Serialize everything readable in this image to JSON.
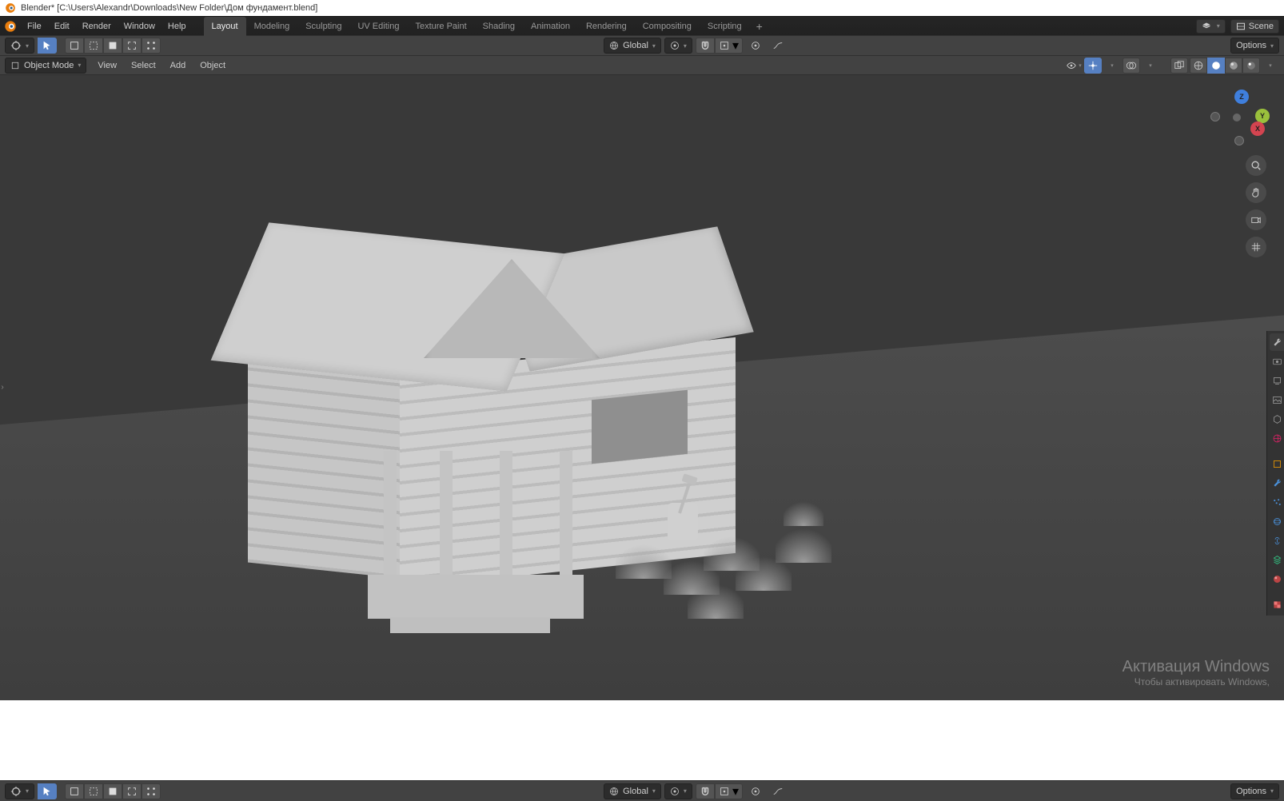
{
  "title": "Blender* [C:\\Users\\Alexandr\\Downloads\\New Folder\\Дом фундамент.blend]",
  "top_menu": {
    "items": [
      "File",
      "Edit",
      "Render",
      "Window",
      "Help"
    ]
  },
  "workspaces": {
    "tabs": [
      "Layout",
      "Modeling",
      "Sculpting",
      "UV Editing",
      "Texture Paint",
      "Shading",
      "Animation",
      "Rendering",
      "Compositing",
      "Scripting"
    ],
    "active": "Layout",
    "add_label": "+"
  },
  "scene": {
    "label": "Scene"
  },
  "header1": {
    "orientation": "Global",
    "options": "Options"
  },
  "header2": {
    "mode": "Object Mode",
    "menus": [
      "View",
      "Select",
      "Add",
      "Object"
    ]
  },
  "gizmo": {
    "x": "X",
    "y": "Y",
    "z": "Z"
  },
  "watermark": {
    "l1": "Активация Windows",
    "l2": "Чтобы активировать Windows,"
  },
  "bottom": {
    "orientation": "Global",
    "options": "Options"
  },
  "icons": {
    "cursor": "cursor-icon",
    "select": "select-icon",
    "move": "move-icon",
    "snap": "snap-icon",
    "pivot": "pivot-icon",
    "proportional": "proportional-icon",
    "overlays": "overlays-icon",
    "gizmo": "gizmo-icon",
    "shading_wire": "wire",
    "shading_solid": "solid",
    "zoom": "zoom-icon",
    "pan": "pan-icon",
    "camera": "camera-icon",
    "persp": "grid-icon"
  },
  "props_tabs": [
    "render",
    "output",
    "view",
    "scene",
    "world",
    "object",
    "modifier",
    "particles",
    "physics",
    "constraint",
    "data",
    "material",
    "texture"
  ]
}
